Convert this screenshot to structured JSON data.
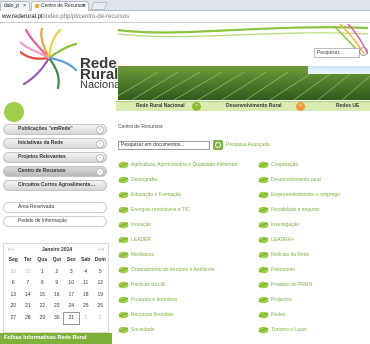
{
  "browser": {
    "tab1_label": "dalo_p",
    "tab2_label": "Centro de Recursos",
    "close_glyph": "×",
    "url_host": "ww.rederural.pt",
    "url_path": "/index.php/pt/centro-de-recursos"
  },
  "header": {
    "brand_line1": "Rede",
    "brand_line2": "Rural",
    "brand_line3": "Nacional",
    "search_placeholder": "Pesquisar..."
  },
  "nav": {
    "items": [
      "Rede Rural Nacional",
      "Desenvolvimento Rural",
      "Redes UE"
    ]
  },
  "sidebar": {
    "menu": [
      "Publicações \"emRede\"",
      "Iniciativas da Rede",
      "Projetos Relevantes",
      "Centro de Recursos",
      "Circuitos Curtos Agroalimenta…"
    ],
    "links": [
      "Área Reservada",
      "Pedido de Informação"
    ],
    "arrow_glyph": "›"
  },
  "calendar": {
    "month": "Janeiro 2014",
    "prev": "«  ‹",
    "next": "›  »",
    "days": [
      "Seg",
      "Ter",
      "Qua",
      "Qui",
      "Sex",
      "Sáb",
      "Dom"
    ],
    "weeks": [
      [
        "30",
        "31",
        "1",
        "2",
        "3",
        "4",
        "5"
      ],
      [
        "6",
        "7",
        "8",
        "9",
        "10",
        "11",
        "12"
      ],
      [
        "13",
        "14",
        "15",
        "16",
        "17",
        "18",
        "19"
      ],
      [
        "20",
        "21",
        "22",
        "23",
        "24",
        "25",
        "26"
      ],
      [
        "27",
        "28",
        "29",
        "30",
        "31",
        "1",
        "2"
      ]
    ]
  },
  "bulletin_title": "Folhas Informativas Rede Rural",
  "main": {
    "title": "Centro de Recursos",
    "search_value": "Pesquisar em documentos...",
    "advanced_search": "Pesquisa Avançada",
    "categories_left": [
      "Agricultura, Agroindústria e Qualidade Alimentar",
      "Demografia",
      "Educação e Formação",
      "Energias renováveis e TIC",
      "Inovação",
      "LEADER",
      "Mediateca",
      "Ordenamento do território e Ambiente",
      "Políticas da UE",
      "Produtos e territórios",
      "Recursos florestais",
      "Sociedade"
    ],
    "categories_right": [
      "Cooperação",
      "Desenvolvimento rural",
      "Empreendedorismo e emprego",
      "Fiscalidade e seguros",
      "Investigação",
      "LEADER+",
      "Notícias da Rede",
      "Património",
      "Prodeps do PRRN",
      "Projectos",
      "Redes",
      "Turismo e Lazer"
    ]
  },
  "colors": {
    "accent_green": "#7cb342",
    "nav_ribbon": "#d9eab2",
    "orange": "#f09a3c"
  }
}
